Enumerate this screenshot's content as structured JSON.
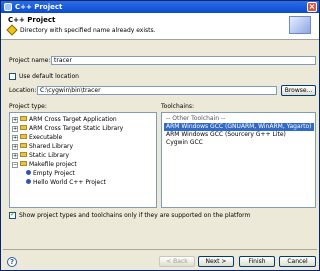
{
  "window": {
    "title": "C++ Project",
    "close_glyph": "×"
  },
  "header": {
    "title": "C++ Project",
    "message": "Directory with specified name already exists."
  },
  "project_name": {
    "label": "Project name:",
    "value": "tracer"
  },
  "default_location": {
    "label": "Use default location",
    "checked": false
  },
  "location": {
    "label": "Location:",
    "value": "C:\\cygwin\\bin\\tracer",
    "browse_label": "Browse..."
  },
  "project_type": {
    "label": "Project type:",
    "items": [
      {
        "label": "ARM Cross Target Application",
        "kind": "folder",
        "expander": "+"
      },
      {
        "label": "ARM Cross Target Static Library",
        "kind": "folder",
        "expander": "+"
      },
      {
        "label": "Executable",
        "kind": "folder",
        "expander": "+"
      },
      {
        "label": "Shared Library",
        "kind": "folder",
        "expander": "+"
      },
      {
        "label": "Static Library",
        "kind": "folder",
        "expander": "+"
      },
      {
        "label": "Makefile project",
        "kind": "folder",
        "expander": "−"
      },
      {
        "label": "Empty Project",
        "kind": "leaf"
      },
      {
        "label": "Hello World C++ Project",
        "kind": "leaf"
      }
    ]
  },
  "toolchains": {
    "label": "Toolchains:",
    "items": [
      {
        "label": "-- Other Toolchain --",
        "selected": false,
        "separator": true
      },
      {
        "label": "ARM Windows GCC (GNUARM, WinARM, Yagarto)",
        "selected": true
      },
      {
        "label": "ARM Windows GCC (Sourcery G++ Lite)",
        "selected": false
      },
      {
        "label": "Cygwin GCC",
        "selected": false
      }
    ]
  },
  "filter": {
    "label": "Show project types and toolchains only if they are supported on the platform",
    "checked": true
  },
  "buttons": {
    "back": "< Back",
    "next": "Next >",
    "finish": "Finish",
    "cancel": "Cancel"
  },
  "colors": {
    "selection": "#316ac5",
    "title_bar": "#0b4ad0",
    "dialog_bg": "#ece9d8"
  }
}
